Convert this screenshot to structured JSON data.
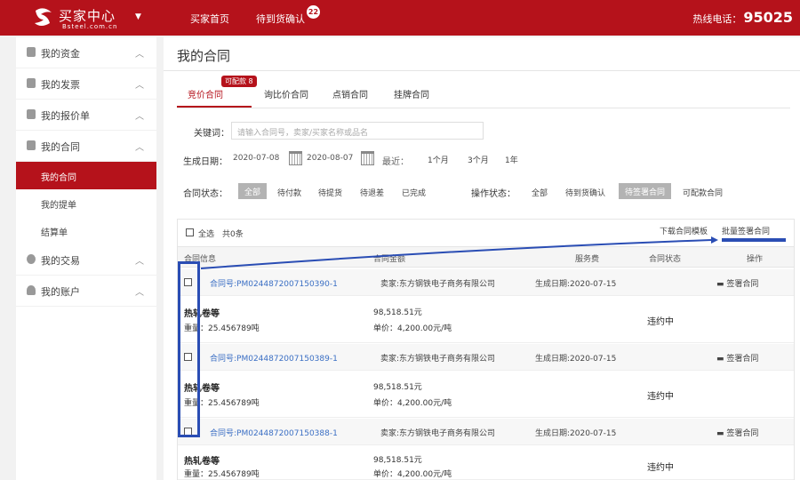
{
  "header": {
    "brand": "买家中心",
    "brand_sub": "Bsteel.com.cn",
    "nav": [
      "买家首页",
      "待到货确认"
    ],
    "nav_badge": "22",
    "hotline_label": "热线电话：",
    "hotline_number": "95025"
  },
  "sidebar": {
    "items": [
      {
        "label": "我的资金"
      },
      {
        "label": "我的发票"
      },
      {
        "label": "我的报价单"
      },
      {
        "label": "我的合同"
      }
    ],
    "subitems": [
      {
        "label": "我的合同"
      },
      {
        "label": "我的提单"
      },
      {
        "label": "结算单"
      }
    ],
    "items_after": [
      {
        "label": "我的交易"
      },
      {
        "label": "我的账户"
      }
    ]
  },
  "main": {
    "title": "我的合同",
    "tabs": [
      {
        "label": "竞价合同",
        "badge": "可配款 8"
      },
      {
        "label": "询比价合同"
      },
      {
        "label": "点销合同"
      },
      {
        "label": "挂牌合同"
      }
    ],
    "filters": {
      "keyword_label": "关键词：",
      "keyword_placeholder": "请输入合同号，卖家/买家名称或品名",
      "date_label": "生成日期：",
      "date_from": "2020-07-08",
      "date_to": "2020-08-07",
      "recent_label": "最近：",
      "recent_options": [
        "1个月",
        "3个月",
        "1年"
      ],
      "contract_status_label": "合同状态：",
      "contract_status_options": [
        "全部",
        "待付款",
        "待提货",
        "待退差",
        "已完成"
      ],
      "op_status_label": "操作状态：",
      "op_status_options": [
        "全部",
        "待到货确认",
        "待签署合同",
        "可配款合同"
      ]
    },
    "list": {
      "select_all": "全选",
      "count": "共0条",
      "download_template": "下载合同模板",
      "batch_sign": "批量签署合同",
      "columns": [
        "合同信息",
        "合同金额",
        "服务费",
        "合同状态",
        "操作"
      ],
      "rows": [
        {
          "contract_no": "合同号:PM02448720071503​90-1",
          "seller": "卖家:东方钢铁电子商务有限公司",
          "created": "生成日期:2020-07-15",
          "product": "热轧卷等",
          "weight": "重量：25.456789吨",
          "amount": "98,518.51元",
          "unit_price": "单价：4,200.00元/吨",
          "status": "违约中",
          "action": "签署合同"
        },
        {
          "contract_no": "合同号:PM0244872007150389-1",
          "seller": "卖家:东方钢铁电子商务有限公司",
          "created": "生成日期:2020-07-15",
          "product": "热轧卷等",
          "weight": "重量：25.456789吨",
          "amount": "98,518.51元",
          "unit_price": "单价：4,200.00元/吨",
          "status": "违约中",
          "action": "签署合同"
        },
        {
          "contract_no": "合同号:PM0244872007150388-1",
          "seller": "卖家:东方钢铁电子商务有限公司",
          "created": "生成日期:2020-07-15",
          "product": "热轧卷等",
          "weight": "重量：25.456789吨",
          "amount": "98,518.51元",
          "unit_price": "单价：4,200.00元/吨",
          "status": "违约中",
          "action": "签署合同"
        }
      ]
    }
  }
}
